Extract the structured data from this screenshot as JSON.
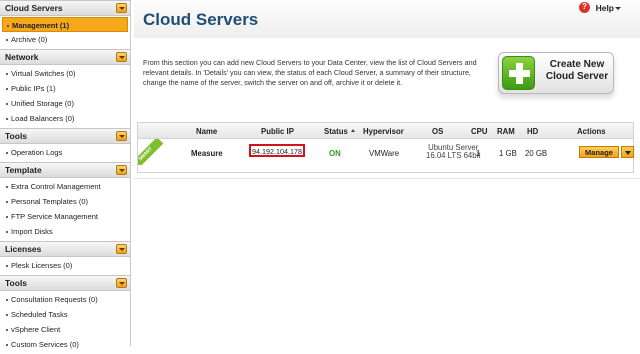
{
  "sidebar": {
    "sections": [
      {
        "title": "Cloud Servers",
        "items": [
          "Management (1)",
          "Archive (0)"
        ]
      },
      {
        "title": "Network",
        "items": [
          "Virtual Switches (0)",
          "Public IPs (1)",
          "Unified Storage (0)",
          "Load Balancers (0)"
        ]
      },
      {
        "title": "Tools",
        "items": [
          "Operation Logs"
        ]
      },
      {
        "title": "Template",
        "items": [
          "Extra Control Management",
          "Personal Templates (0)",
          "FTP Service Management",
          "Import Disks"
        ]
      },
      {
        "title": "Licenses",
        "items": [
          "Plesk Licenses (0)"
        ]
      },
      {
        "title": "Tools",
        "items": [
          "Consultation Requests (0)",
          "Scheduled Tasks",
          "vSphere Client",
          "Custom Services (0)"
        ]
      }
    ],
    "active_item": "Management (1)"
  },
  "header": {
    "title": "Cloud Servers",
    "help_label": "Help"
  },
  "intro": {
    "text": "From this section you can add new Cloud Servers to your Data Center, view the list of Cloud Servers and relevant details. In 'Details' you can view, the status of each Cloud Server, a summary of their structure, change the name of the server, switch the server on and off, archive it or delete it."
  },
  "create_button": {
    "label": "Create New Cloud Server"
  },
  "table": {
    "columns": [
      "Name",
      "Public IP",
      "Status",
      "Hypervisor",
      "OS",
      "CPU",
      "RAM",
      "HD",
      "Actions"
    ],
    "rows": [
      {
        "badge": "SMART",
        "name": "Measure",
        "public_ip": "94.192.104.178",
        "status": "ON",
        "hypervisor": "VMWare",
        "os_line1": "Ubuntu Server",
        "os_line2": "16.04 LTS 64bit",
        "cpu": "1",
        "ram": "1 GB",
        "hd": "20 GB",
        "action": "Manage"
      }
    ]
  },
  "colors": {
    "accent": "#f5a81c",
    "title": "#1f4e79",
    "status_on": "#2f9a1e",
    "highlight": "#d0141c"
  }
}
